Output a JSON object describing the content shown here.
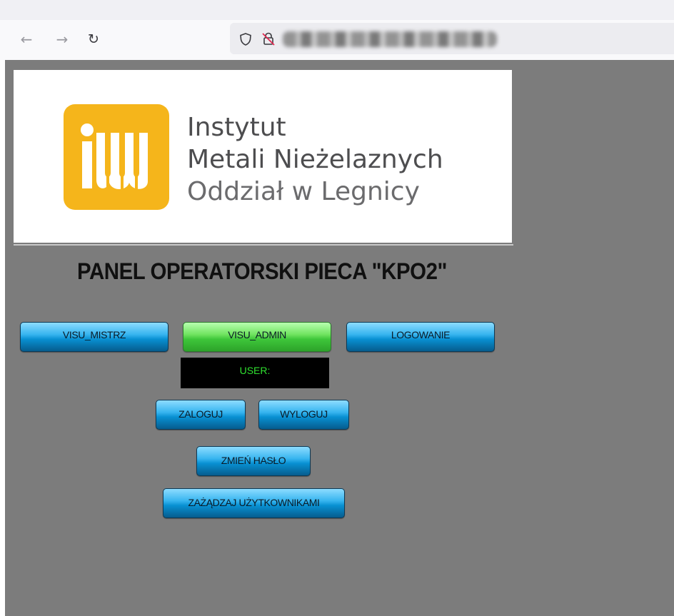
{
  "browser": {
    "back_icon": "arrow-left-icon",
    "forward_icon": "arrow-right-icon",
    "reload_icon": "reload-icon",
    "shield_icon": "shield-icon",
    "insecure_lock_icon": "lock-insecure-icon"
  },
  "logo": {
    "line1": "Instytut",
    "line2": "Metali Nieżelaznych",
    "line3": "Oddział w Legnicy",
    "mark_color": "#f5b51b"
  },
  "panel": {
    "title": "PANEL OPERATORSKI PIECA \"KPO2\"",
    "background_color": "#7c7c7c"
  },
  "nav_buttons": {
    "mistrz": "VISU_MISTRZ",
    "admin": "VISU_ADMIN",
    "logowanie": "LOGOWANIE"
  },
  "user_status": {
    "label": "USER:",
    "text_color": "#2fe02f"
  },
  "actions": {
    "zaloguj": "ZALOGUJ",
    "wyloguj": "WYLOGUJ",
    "zmien_haslo": "ZMIEŃ HASŁO",
    "zarzadzaj": "ZAŻĄDZAJ UŻYTKOWNIKAMI"
  },
  "colors": {
    "button_blue": "#0890d2",
    "button_green_active": "#3ec63a"
  }
}
